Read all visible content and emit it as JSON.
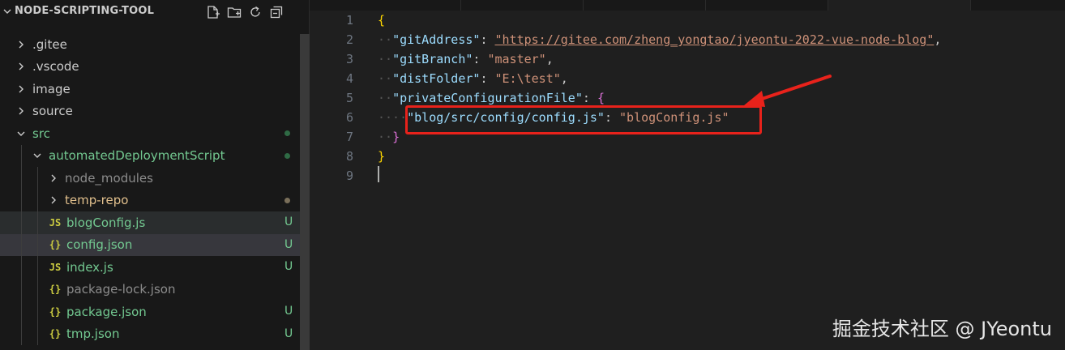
{
  "explorer": {
    "project_title": "NODE-SCRIPTING-TOOL",
    "actions": [
      {
        "name": "new-file-icon"
      },
      {
        "name": "new-folder-icon"
      },
      {
        "name": "refresh-icon"
      },
      {
        "name": "collapse-all-icon"
      }
    ],
    "items": [
      {
        "label": ".gitee",
        "kind": "folder",
        "expanded": false,
        "depth": 0,
        "color": "#cccccc",
        "git": ""
      },
      {
        "label": ".vscode",
        "kind": "folder",
        "expanded": false,
        "depth": 0,
        "color": "#cccccc",
        "git": ""
      },
      {
        "label": "image",
        "kind": "folder",
        "expanded": false,
        "depth": 0,
        "color": "#cccccc",
        "git": ""
      },
      {
        "label": "source",
        "kind": "folder",
        "expanded": false,
        "depth": 0,
        "color": "#cccccc",
        "git": ""
      },
      {
        "label": "src",
        "kind": "folder",
        "expanded": true,
        "depth": 0,
        "color": "#73c991",
        "git": "dot-green"
      },
      {
        "label": "automatedDeploymentScript",
        "kind": "folder",
        "expanded": true,
        "depth": 1,
        "color": "#73c991",
        "git": "dot-green"
      },
      {
        "label": "node_modules",
        "kind": "folder",
        "expanded": false,
        "depth": 2,
        "color": "#8c8c8c",
        "git": ""
      },
      {
        "label": "temp-repo",
        "kind": "folder",
        "expanded": false,
        "depth": 2,
        "color": "#e2c08d",
        "git": "dot-gray"
      },
      {
        "label": "blogConfig.js",
        "kind": "js",
        "depth": 2,
        "color": "#73c991",
        "git": "U",
        "state": "hover"
      },
      {
        "label": "config.json",
        "kind": "json",
        "depth": 2,
        "color": "#73c991",
        "git": "U",
        "state": "selected"
      },
      {
        "label": "index.js",
        "kind": "js",
        "depth": 2,
        "color": "#73c991",
        "git": "U"
      },
      {
        "label": "package-lock.json",
        "kind": "json",
        "depth": 2,
        "color": "#8c8c8c",
        "git": ""
      },
      {
        "label": "package.json",
        "kind": "json",
        "depth": 2,
        "color": "#73c991",
        "git": "U"
      },
      {
        "label": "tmp.json",
        "kind": "json",
        "depth": 2,
        "color": "#73c991",
        "git": "U"
      }
    ],
    "js_icon": "JS",
    "json_icon": "{}",
    "untracked_badge": "U"
  },
  "editor": {
    "line_numbers": [
      "1",
      "2",
      "3",
      "4",
      "5",
      "6",
      "7",
      "8",
      "9"
    ],
    "lines": {
      "l1_open": "{",
      "l2_key": "\"gitAddress\"",
      "l2_val": "\"https://gitee.com/zheng_yongtao/jyeontu-2022-vue-node-blog\"",
      "l3_key": "\"gitBranch\"",
      "l3_val": "\"master\"",
      "l4_key": "\"distFolder\"",
      "l4_val": "\"E:\\test\"",
      "l5_key": "\"privateConfigurationFile\"",
      "l5_open": "{",
      "l6_key": "\"blog/src/config/config.js\"",
      "l6_val": "\"blogConfig.js\"",
      "l7_close": "}",
      "l8_close": "}"
    },
    "annotation_color": "#e8221b"
  },
  "watermark": "掘金技术社区 @ JYeontu",
  "colors": {
    "sidebar_bg": "#181818",
    "editor_bg": "#1f1f1f",
    "git_untracked": "#73c991",
    "key": "#9cdcfe",
    "string": "#ce9178",
    "bracket_gold": "#ffd700",
    "bracket_purple": "#da70d6"
  }
}
